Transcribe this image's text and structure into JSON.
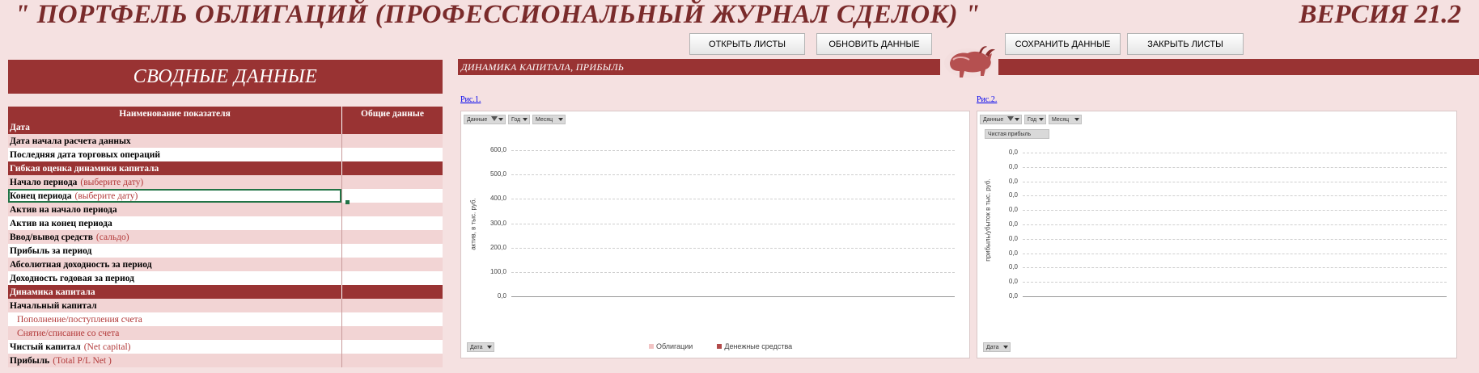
{
  "header": {
    "title": "\" ПОРТФЕЛЬ ОБЛИГАЦИЙ (ПРОФЕССИОНАЛЬНЫЙ ЖУРНАЛ СДЕЛОК) \"",
    "version": "ВЕРСИЯ 21.2"
  },
  "toolbar": {
    "open_label": "ОТКРЫТЬ ЛИСТЫ",
    "refresh_label": "ОБНОВИТЬ ДАННЫЕ",
    "save_label": "СОХРАНИТЬ ДАННЫЕ",
    "close_label": "ЗАКРЫТЬ ЛИСТЫ"
  },
  "summary": {
    "title": "СВОДНЫЕ ДАННЫЕ",
    "col_name": "Наименование показателя",
    "col_total": "Общие данные",
    "rows": [
      {
        "type": "section",
        "label": "Дата"
      },
      {
        "type": "pink",
        "label": "Дата начала расчета данных",
        "note": ""
      },
      {
        "type": "white",
        "label": "Последняя дата торговых операций",
        "note": ""
      },
      {
        "type": "section",
        "label": "Гибкая оценка динамики капитала"
      },
      {
        "type": "pink",
        "label": "Начало периода",
        "note": "(выберите дату)"
      },
      {
        "type": "white",
        "label": "Конец периода",
        "note": "(выберите дату)"
      },
      {
        "type": "pink",
        "label": "Актив на начало периода",
        "note": ""
      },
      {
        "type": "white",
        "label": "Актив на конец периода",
        "note": ""
      },
      {
        "type": "pink",
        "label": "Ввод/вывод средств",
        "note": "(сальдо)"
      },
      {
        "type": "white",
        "label": "Прибыль за период",
        "note": ""
      },
      {
        "type": "pink",
        "label": "Абсолютная доходность за период",
        "note": ""
      },
      {
        "type": "white",
        "label": "Доходность годовая за период",
        "note": ""
      },
      {
        "type": "section",
        "label": "Динамика капитала"
      },
      {
        "type": "pink",
        "label": "Начальный капитал",
        "note": ""
      },
      {
        "type": "white",
        "label": "",
        "sub": "Пополнение/поступления счета"
      },
      {
        "type": "pink",
        "label": "",
        "sub": "Снятие/списание со счета"
      },
      {
        "type": "white",
        "label": "Чистый капитал",
        "note": "(Net capital)"
      },
      {
        "type": "pink",
        "label": "Прибыль",
        "note": "(Total P/L Net )"
      }
    ]
  },
  "banner": {
    "title": "ДИНАМИКА КАПИТАЛА, ПРИБЫЛЬ"
  },
  "fig1": {
    "link": "Рис.1.",
    "ctrl_data": "Данные",
    "ctrl_year": "Год",
    "ctrl_month": "Месяц",
    "ctrl_date": "Дата",
    "ylabel": "актив, в тыс. руб.",
    "ticks": [
      "600,0",
      "500,0",
      "400,0",
      "300,0",
      "200,0",
      "100,0",
      "0,0"
    ],
    "legend": [
      {
        "name": "Облигации",
        "color": "#f2c4c4"
      },
      {
        "name": "Денежные средства",
        "color": "#b24a4a"
      }
    ]
  },
  "fig2": {
    "link": "Рис.2.",
    "ctrl_data": "Данные",
    "ctrl_year": "Год",
    "ctrl_month": "Месяц",
    "ctrl_date": "Дата",
    "series_btn": "Чистая прибыль",
    "ylabel": "прибыль/убыток в тыс. руб.",
    "ticks": [
      "0,0",
      "0,0",
      "0,0",
      "0,0",
      "0,0",
      "0,0",
      "0,0",
      "0,0",
      "0,0",
      "0,0",
      "0,0"
    ]
  }
}
